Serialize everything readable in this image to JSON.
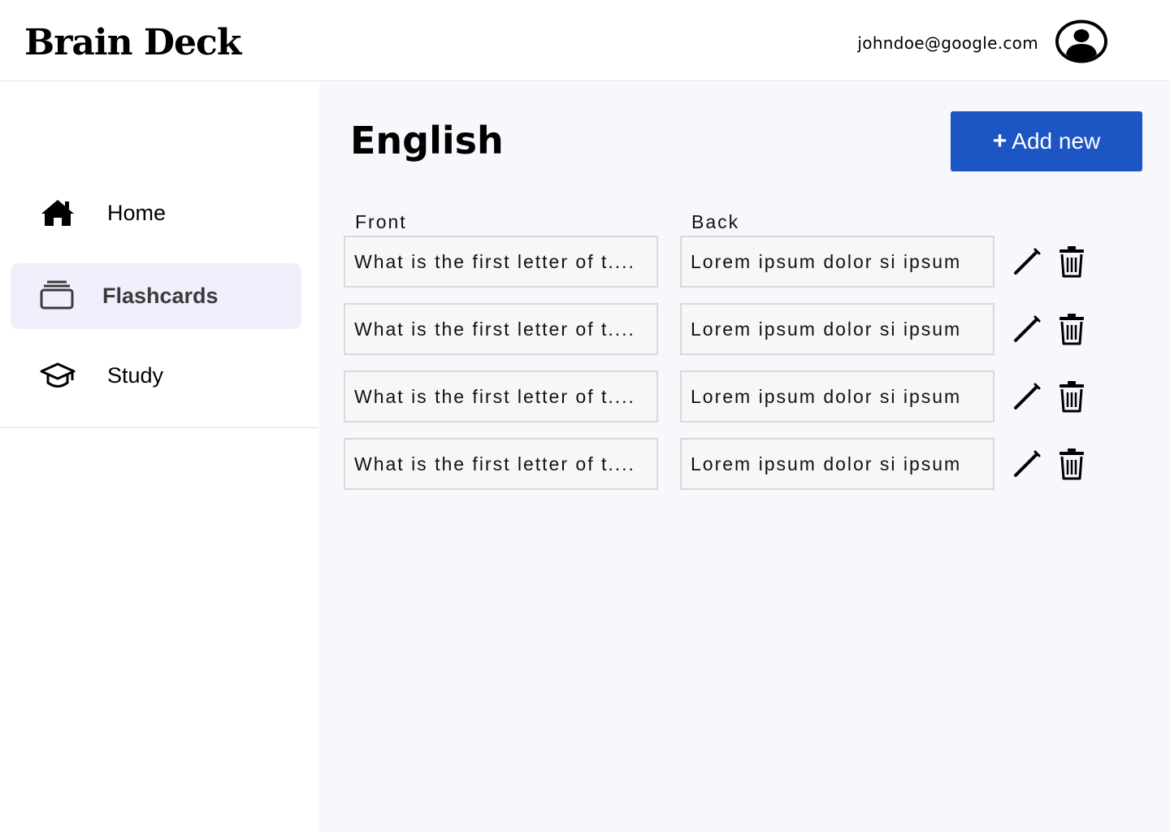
{
  "app": {
    "title": "Brain Deck",
    "user_email": "johndoe@google.com",
    "accent_color": "#1e55c4"
  },
  "sidebar": {
    "items": [
      {
        "label": "Home",
        "icon": "home-icon",
        "active": false
      },
      {
        "label": "Flashcards",
        "icon": "cards-icon",
        "active": true
      },
      {
        "label": "Study",
        "icon": "graduation-cap-icon",
        "active": false
      }
    ]
  },
  "main": {
    "title": "English",
    "add_button_label": "Add new",
    "add_button_icon": "+",
    "columns": {
      "front": "Front",
      "back": "Back"
    },
    "cards": [
      {
        "front": "What is the first letter  of t....",
        "back": "Lorem ipsum dolor si ipsum"
      },
      {
        "front": "What is the first letter  of t....",
        "back": "Lorem ipsum dolor si ipsum"
      },
      {
        "front": "What is the first letter  of t....",
        "back": "Lorem ipsum dolor si ipsum"
      },
      {
        "front": "What is the first letter  of t....",
        "back": "Lorem ipsum dolor si ipsum"
      }
    ]
  }
}
